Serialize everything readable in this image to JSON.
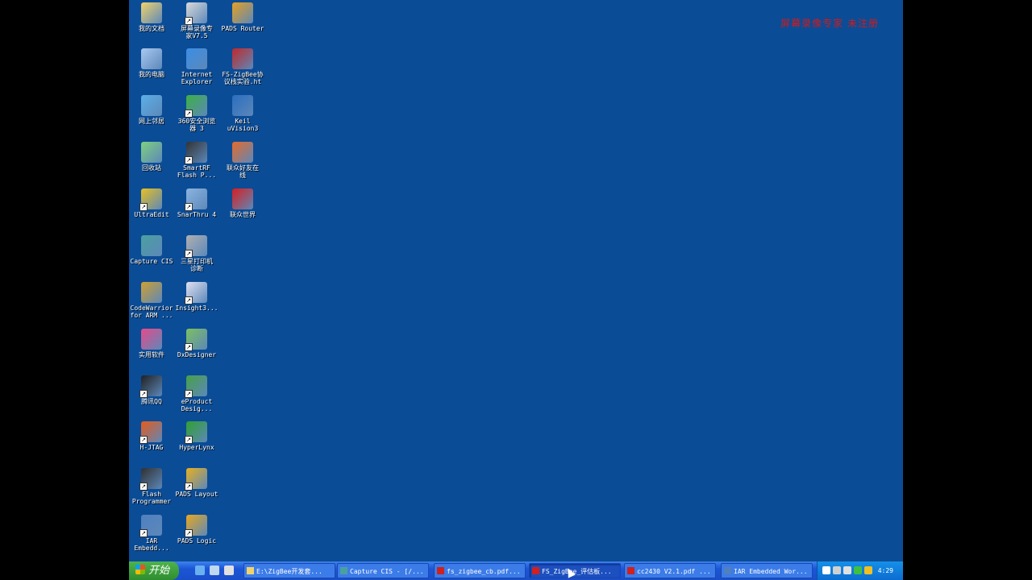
{
  "watermark": "屏幕录像专家 未注册",
  "desktop_icons": [
    {
      "label": "我的文档",
      "icon": "my-documents-icon",
      "color": "#f2d36b",
      "shortcut": false
    },
    {
      "label": "屏幕录像专\n家V7.5",
      "icon": "screen-recorder-icon",
      "color": "#d9d9d9",
      "shortcut": true
    },
    {
      "label": "PADS Router",
      "icon": "pads-router-icon",
      "color": "#e8a020",
      "shortcut": false
    },
    {
      "label": "我的电脑",
      "icon": "my-computer-icon",
      "color": "#a9c8f0",
      "shortcut": false
    },
    {
      "label": "Internet\nExplorer",
      "icon": "internet-explorer-icon",
      "color": "#3a8ee6",
      "shortcut": false
    },
    {
      "label": "FS-ZigBee协\n议栈实验.ht",
      "icon": "fs-zigbee-doc-icon",
      "color": "#c0282a",
      "shortcut": false
    },
    {
      "label": "网上邻居",
      "icon": "network-places-icon",
      "color": "#5ab0e8",
      "shortcut": false
    },
    {
      "label": "360安全浏览\n器 3",
      "icon": "360-browser-icon",
      "color": "#3cb043",
      "shortcut": true
    },
    {
      "label": "Keil\nuVision3",
      "icon": "keil-uvision-icon",
      "color": "#2a6ec0",
      "shortcut": false
    },
    {
      "label": "回收站",
      "icon": "recycle-bin-icon",
      "color": "#7fd07f",
      "shortcut": false
    },
    {
      "label": "SmartRF\nFlash P...",
      "icon": "smartrf-flash-icon",
      "color": "#333333",
      "shortcut": true
    },
    {
      "label": "联众好友在\n线",
      "icon": "lianzhong-friends-icon",
      "color": "#e86a2a",
      "shortcut": false
    },
    {
      "label": "UltraEdit",
      "icon": "ultraedit-icon",
      "color": "#e8c020",
      "shortcut": true
    },
    {
      "label": "SnarThru 4",
      "icon": "smarthru-icon",
      "color": "#8ab4e0",
      "shortcut": true
    },
    {
      "label": "联众世界",
      "icon": "lianzhong-world-icon",
      "color": "#d81e1e",
      "shortcut": false
    },
    {
      "label": "Capture CIS",
      "icon": "capture-cis-icon",
      "color": "#4aa0a0",
      "shortcut": false
    },
    {
      "label": "三星打印机\n诊断",
      "icon": "samsung-printer-icon",
      "color": "#b0b0b0",
      "shortcut": true
    },
    {
      "label": "CodeWarrior\nfor ARM ...",
      "icon": "codewarrior-icon",
      "color": "#d0a030",
      "shortcut": false
    },
    {
      "label": "Insight3...",
      "icon": "insight3-icon",
      "color": "#e0e0f0",
      "shortcut": true
    },
    {
      "label": "实用软件",
      "icon": "utilities-folder-icon",
      "color": "#e84a8a",
      "shortcut": false
    },
    {
      "label": "DxDesigner",
      "icon": "dxdesigner-icon",
      "color": "#7cc060",
      "shortcut": true
    },
    {
      "label": "腾讯QQ",
      "icon": "tencent-qq-icon",
      "color": "#202020",
      "shortcut": true
    },
    {
      "label": "eProduct\nDesig...",
      "icon": "eproduct-designer-icon",
      "color": "#48a048",
      "shortcut": true
    },
    {
      "label": "H-JTAG",
      "icon": "h-jtag-icon",
      "color": "#e85a1a",
      "shortcut": true
    },
    {
      "label": "HyperLynx",
      "icon": "hyperlynx-icon",
      "color": "#30a030",
      "shortcut": true
    },
    {
      "label": "Flash\nProgrammer",
      "icon": "flash-programmer-icon",
      "color": "#303030",
      "shortcut": true
    },
    {
      "label": "PADS Layout",
      "icon": "pads-layout-icon",
      "color": "#e8b020",
      "shortcut": true
    },
    {
      "label": "IAR\nEmbedd...",
      "icon": "iar-embedded-icon",
      "color": "#5080c0",
      "shortcut": true
    },
    {
      "label": "PADS Logic",
      "icon": "pads-logic-icon",
      "color": "#e8a820",
      "shortcut": true
    }
  ],
  "taskbar": {
    "start_label": "开始",
    "quick_launch": [
      {
        "icon": "ie-quicklaunch-icon",
        "color": "#6ab0f0"
      },
      {
        "icon": "show-desktop-icon",
        "color": "#c0d8f0"
      },
      {
        "icon": "media-player-icon",
        "color": "#e0e0e0"
      }
    ],
    "tasks": [
      {
        "label": "E:\\ZigBee开发套...",
        "icon": "folder-task-icon",
        "color": "#f2d36b",
        "active": false
      },
      {
        "label": "Capture CIS - [/...",
        "icon": "capture-task-icon",
        "color": "#4aa0a0",
        "active": false
      },
      {
        "label": "fs_zigbee_cb.pdf...",
        "icon": "pdf-task-icon",
        "color": "#d02020",
        "active": false
      },
      {
        "label": "FS_ZigBee_评估板...",
        "icon": "pdf-task-icon",
        "color": "#d02020",
        "active": true
      },
      {
        "label": "cc2430 V2.1.pdf ...",
        "icon": "pdf-task-icon",
        "color": "#d02020",
        "active": false
      },
      {
        "label": "IAR Embedded Wor...",
        "icon": "iar-task-icon",
        "color": "#5080c0",
        "active": false
      }
    ],
    "tray_icons": [
      {
        "icon": "tray-back-icon",
        "color": "#ffffff"
      },
      {
        "icon": "tray-network-icon",
        "color": "#d0d0d0"
      },
      {
        "icon": "tray-volume-icon",
        "color": "#e0e0e0"
      },
      {
        "icon": "tray-360-icon",
        "color": "#40c040"
      },
      {
        "icon": "tray-security-icon",
        "color": "#f0c020"
      }
    ],
    "clock": "4:29"
  }
}
